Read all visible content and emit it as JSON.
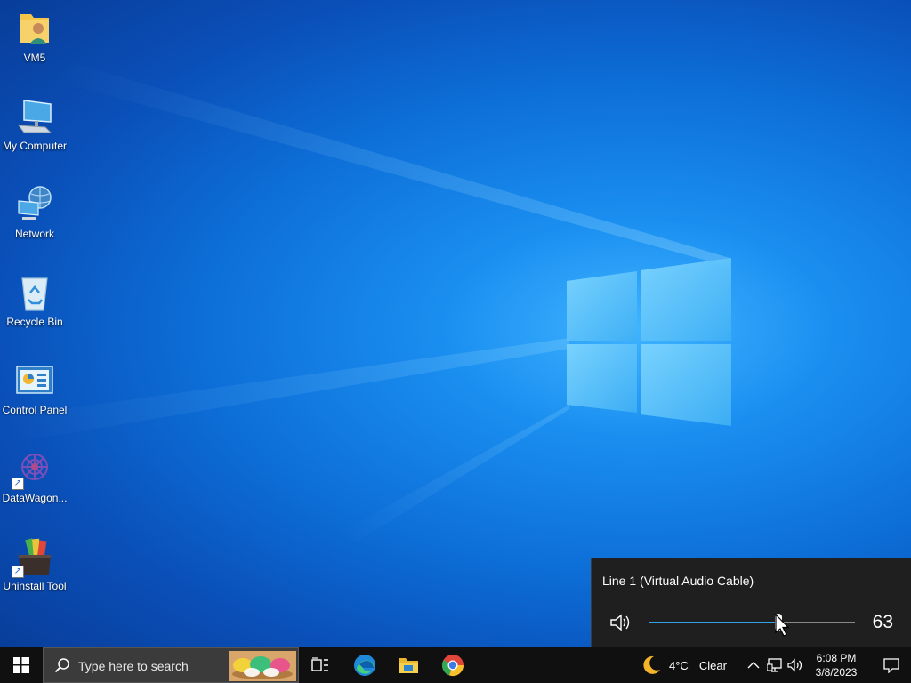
{
  "desktop": {
    "icons": [
      {
        "label": "VM5",
        "icon": "user-folder-icon"
      },
      {
        "label": "My Computer",
        "icon": "computer-icon"
      },
      {
        "label": "Network",
        "icon": "network-icon"
      },
      {
        "label": "Recycle Bin",
        "icon": "recycle-bin-icon"
      },
      {
        "label": "Control Panel",
        "icon": "control-panel-icon"
      },
      {
        "label": "DataWagon...",
        "icon": "datawagon-icon"
      },
      {
        "label": "Uninstall Tool",
        "icon": "uninstall-tool-icon"
      }
    ]
  },
  "volume": {
    "device": "Line 1 (Virtual Audio Cable)",
    "level": 63,
    "icon": "speaker-icon"
  },
  "taskbar": {
    "search_placeholder": "Type here to search",
    "apps": [
      {
        "name": "Task View",
        "icon": "task-view-icon"
      },
      {
        "name": "Microsoft Edge",
        "icon": "edge-icon"
      },
      {
        "name": "File Explorer",
        "icon": "file-explorer-icon"
      },
      {
        "name": "Google Chrome",
        "icon": "chrome-icon"
      }
    ],
    "weather": {
      "temp": "4°C",
      "condition": "Clear",
      "icon": "moon-icon"
    },
    "clock": {
      "time": "6:08 PM",
      "date": "3/8/2023"
    }
  },
  "colors": {
    "accent": "#3aa0e8",
    "taskbar": "#101010",
    "flyout": "#1f1f1f"
  }
}
